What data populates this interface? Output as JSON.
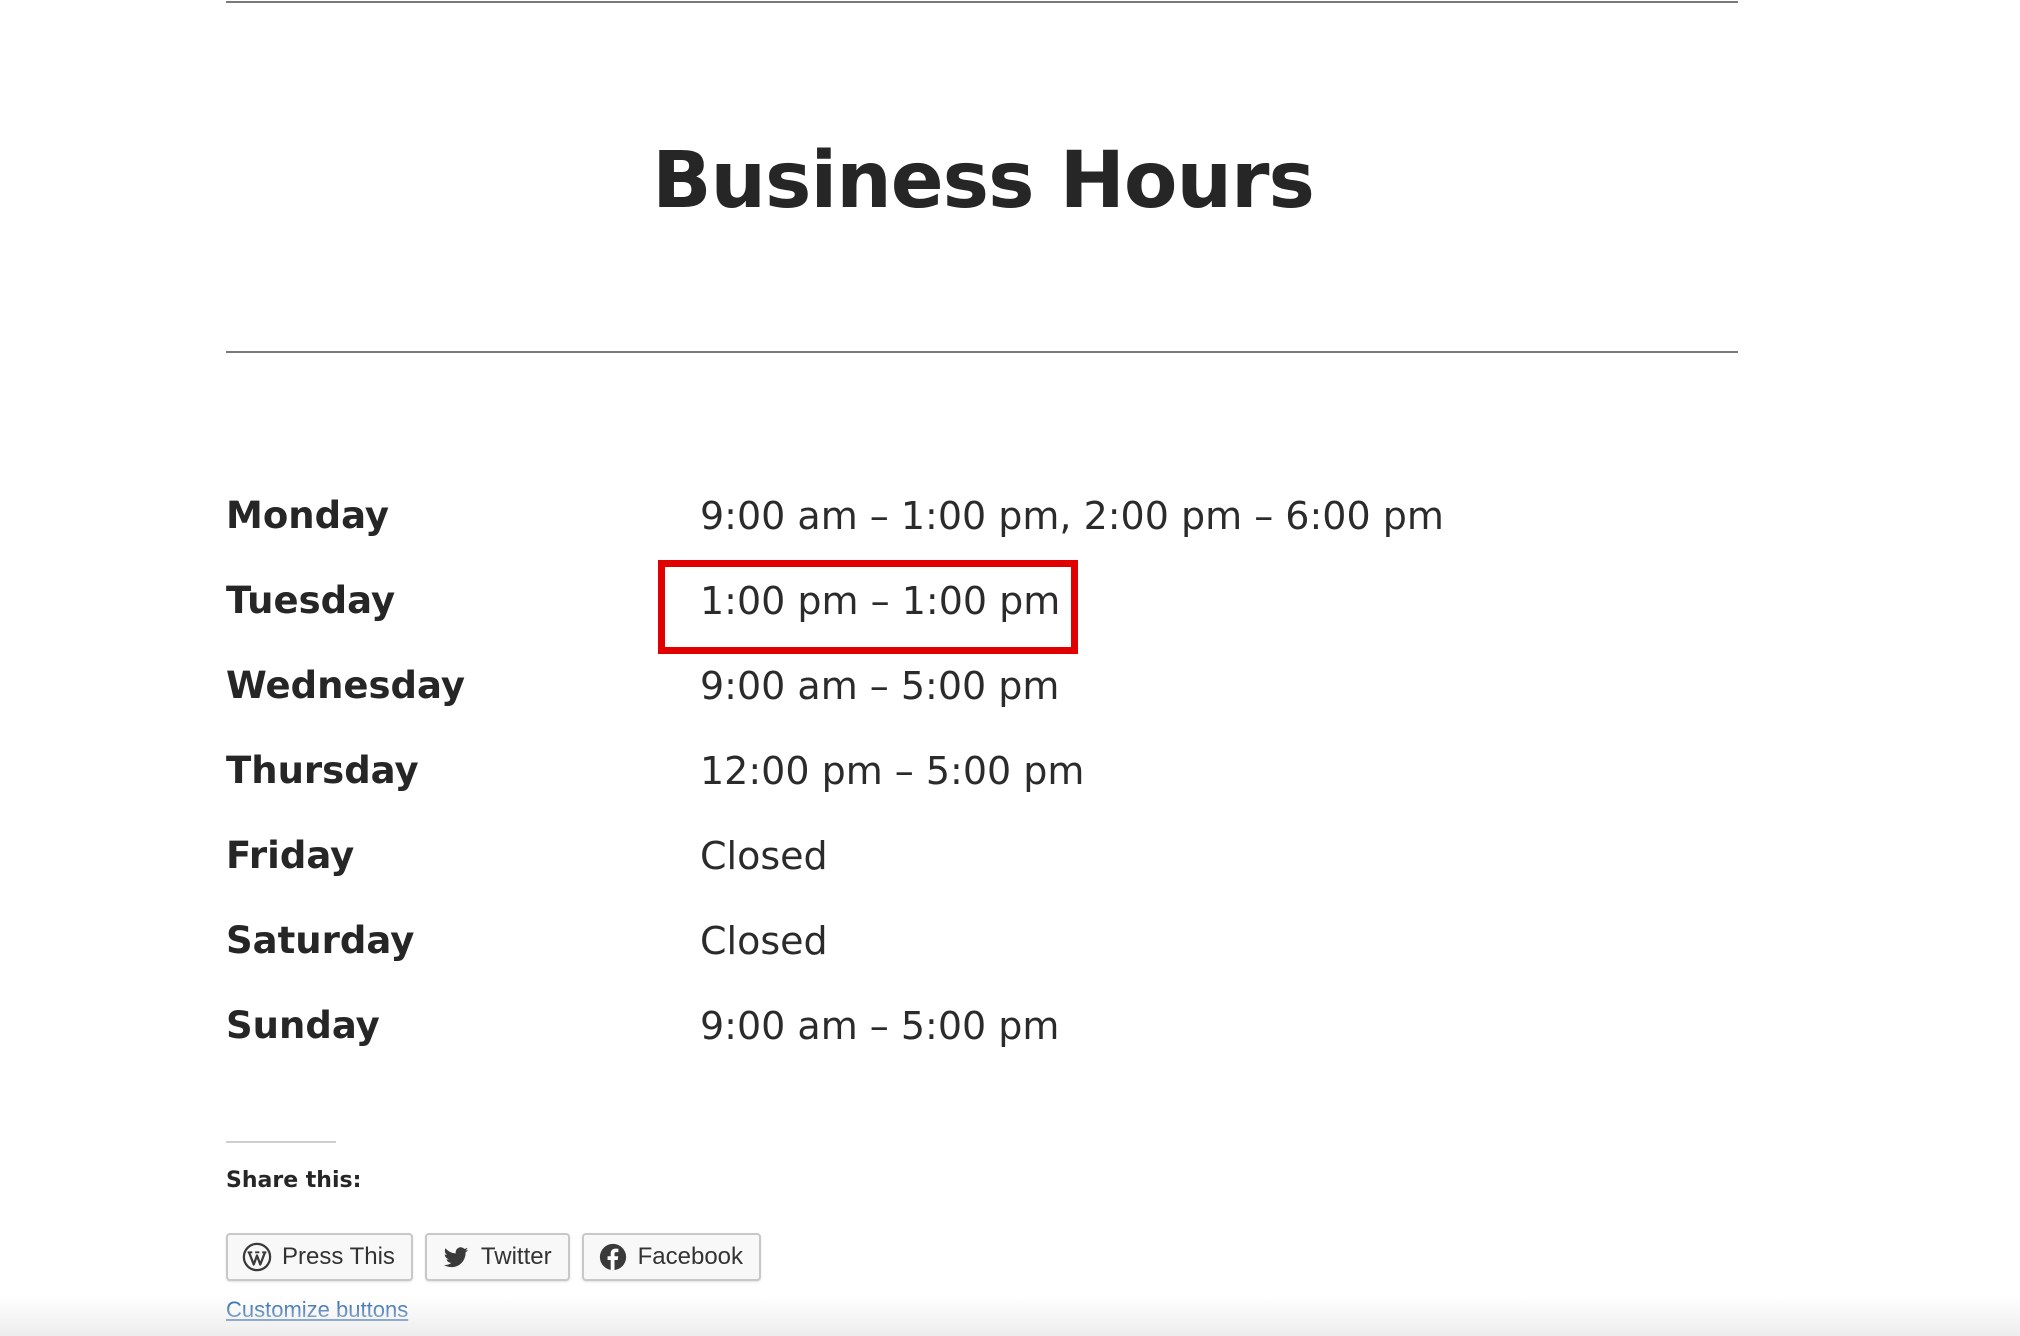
{
  "page": {
    "title": "Business Hours"
  },
  "hours": [
    {
      "day": "Monday",
      "hours": "9:00 am – 1:00 pm, 2:00 pm – 6:00 pm"
    },
    {
      "day": "Tuesday",
      "hours": "1:00 pm – 1:00 pm"
    },
    {
      "day": "Wednesday",
      "hours": "9:00 am – 5:00 pm"
    },
    {
      "day": "Thursday",
      "hours": "12:00 pm – 5:00 pm"
    },
    {
      "day": "Friday",
      "hours": "Closed"
    },
    {
      "day": "Saturday",
      "hours": "Closed"
    },
    {
      "day": "Sunday",
      "hours": "9:00 am – 5:00 pm"
    }
  ],
  "highlight": {
    "color": "#e10000",
    "target_day": "Tuesday"
  },
  "share": {
    "heading": "Share this:",
    "buttons": [
      {
        "label": "Press This",
        "icon": "wordpress-icon"
      },
      {
        "label": "Twitter",
        "icon": "twitter-icon"
      },
      {
        "label": "Facebook",
        "icon": "facebook-icon"
      }
    ],
    "customize_label": "Customize buttons"
  },
  "colors": {
    "text": "#2b2b2b",
    "link": "#1f5fa8",
    "highlight": "#e10000"
  }
}
